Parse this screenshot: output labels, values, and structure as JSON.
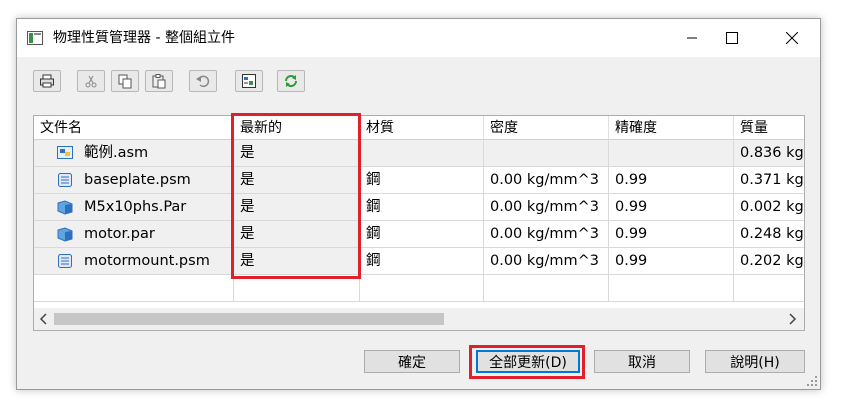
{
  "window": {
    "title": "物理性質管理器 - 整個組立件",
    "minimize_icon": "minimize-icon",
    "maximize_icon": "maximize-icon",
    "close_icon": "close-icon"
  },
  "toolbar": {
    "buttons": [
      "print-icon",
      "cut-icon",
      "copy-icon",
      "paste-icon",
      "undo-icon",
      "properties-icon",
      "refresh-icon"
    ]
  },
  "table": {
    "columns": [
      "文件名",
      "最新的",
      "材質",
      "密度",
      "精確度",
      "質量"
    ],
    "rows": [
      {
        "icon": "assembly-icon",
        "name": "範例.asm",
        "latest": "是",
        "material": "",
        "density": "",
        "accuracy": "",
        "mass": "0.836 kg"
      },
      {
        "icon": "sheetmetal-icon",
        "name": "baseplate.psm",
        "latest": "是",
        "material": "鋼",
        "density": "0.00 kg/mm^3",
        "accuracy": "0.99",
        "mass": "0.371 kg"
      },
      {
        "icon": "part-icon",
        "name": "M5x10phs.Par",
        "latest": "是",
        "material": "鋼",
        "density": "0.00 kg/mm^3",
        "accuracy": "0.99",
        "mass": "0.002 kg"
      },
      {
        "icon": "part-icon",
        "name": "motor.par",
        "latest": "是",
        "material": "鋼",
        "density": "0.00 kg/mm^3",
        "accuracy": "0.99",
        "mass": "0.248 kg"
      },
      {
        "icon": "sheetmetal-icon",
        "name": "motormount.psm",
        "latest": "是",
        "material": "鋼",
        "density": "0.00 kg/mm^3",
        "accuracy": "0.99",
        "mass": "0.202 kg"
      }
    ]
  },
  "buttons": {
    "ok": "確定",
    "update_all": "全部更新(D)",
    "cancel": "取消",
    "help": "說明(H)"
  },
  "colors": {
    "highlight": "#e0212b",
    "focus": "#0078d7"
  }
}
